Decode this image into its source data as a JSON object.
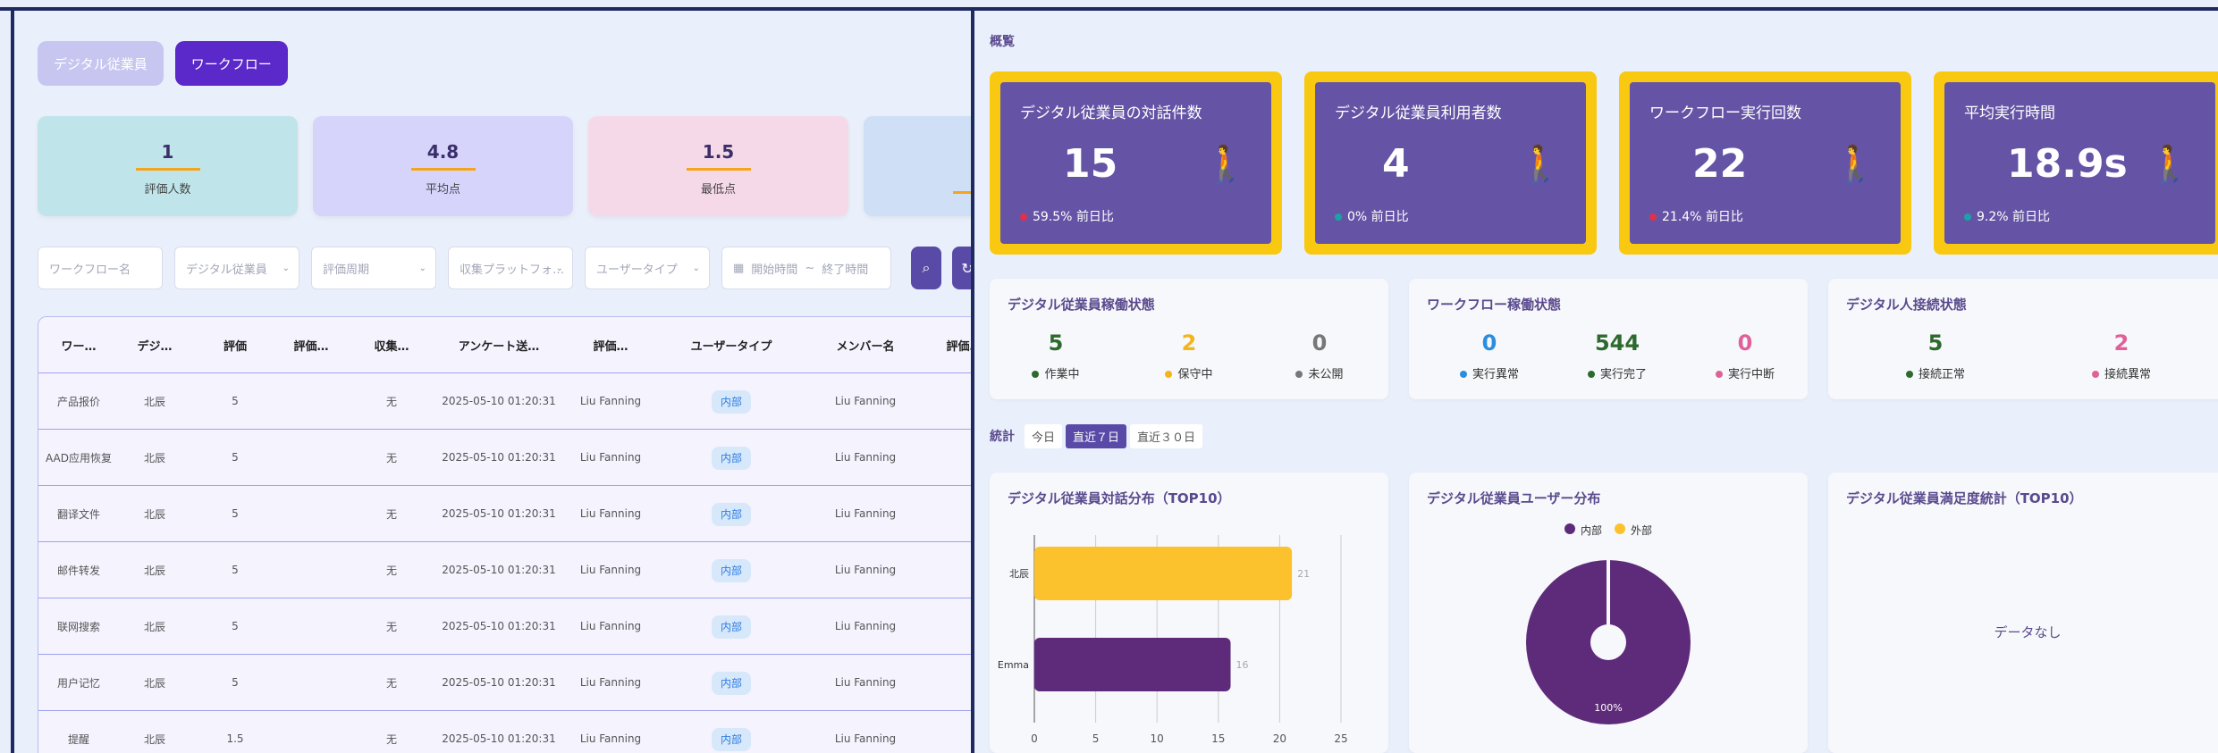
{
  "tabs": {
    "digital": "デジタル従業員",
    "workflow": "ワークフロー"
  },
  "stats": [
    {
      "value": "1",
      "label": "評価人数",
      "bg": "#bfe5ea"
    },
    {
      "value": "4.8",
      "label": "平均点",
      "bg": "#d6d4fb"
    },
    {
      "value": "1.5",
      "label": "最低点",
      "bg": "#f6d9e8"
    }
  ],
  "filters": {
    "workflow_name": "ワークフロー名",
    "digital_employee": "デジタル従業員",
    "eval_period": "評価周期",
    "platform": "収集プラットフォ…",
    "user_type": "ユーザータイプ",
    "start_time": "開始時間",
    "date_sep": "~",
    "end_time": "終了時間"
  },
  "table": {
    "headers": [
      "ワー…",
      "デジ…",
      "評価",
      "評価…",
      "収集…",
      "アンケート送…",
      "評価…",
      "ユーザータイプ",
      "メンバー名",
      "評価…"
    ],
    "rows": [
      [
        "产品报价",
        "北辰",
        "5",
        "",
        "无",
        "2025-05-10 01:20:31",
        "Liu Fanning",
        "内部",
        "Liu Fanning"
      ],
      [
        "AAD应用恢复",
        "北辰",
        "5",
        "",
        "无",
        "2025-05-10 01:20:31",
        "Liu Fanning",
        "内部",
        "Liu Fanning"
      ],
      [
        "翻译文件",
        "北辰",
        "5",
        "",
        "无",
        "2025-05-10 01:20:31",
        "Liu Fanning",
        "内部",
        "Liu Fanning"
      ],
      [
        "邮件转发",
        "北辰",
        "5",
        "",
        "无",
        "2025-05-10 01:20:31",
        "Liu Fanning",
        "内部",
        "Liu Fanning"
      ],
      [
        "联网搜索",
        "北辰",
        "5",
        "",
        "无",
        "2025-05-10 01:20:31",
        "Liu Fanning",
        "内部",
        "Liu Fanning"
      ],
      [
        "用户记忆",
        "北辰",
        "5",
        "",
        "无",
        "2025-05-10 01:20:31",
        "Liu Fanning",
        "内部",
        "Liu Fanning"
      ],
      [
        "提醒",
        "北辰",
        "1.5",
        "",
        "无",
        "2025-05-10 01:20:31",
        "Liu Fanning",
        "内部",
        "Liu Fanning"
      ]
    ]
  },
  "overview": {
    "title": "概覧"
  },
  "kpis": [
    {
      "title": "デジタル従業員の対話件数",
      "value": "15",
      "change": "59.5%",
      "suffix": "前日比",
      "dot": "#e0304a"
    },
    {
      "title": "デジタル従業員利用者数",
      "value": "4",
      "change": "0%",
      "suffix": "前日比",
      "dot": "#1aa3a3"
    },
    {
      "title": "ワークフロー実行回数",
      "value": "22",
      "change": "21.4%",
      "suffix": "前日比",
      "dot": "#e0304a"
    },
    {
      "title": "平均実行時間",
      "value": "18.9s",
      "change": "9.2%",
      "suffix": "前日比",
      "dot": "#1aa3a3"
    }
  ],
  "status": {
    "employee": {
      "title": "デジタル従業員稼働状態",
      "items": [
        {
          "v": "5",
          "l": "作業中",
          "c": "#2d6a2d"
        },
        {
          "v": "2",
          "l": "保守中",
          "c": "#f2b51e"
        },
        {
          "v": "0",
          "l": "未公開",
          "c": "#777"
        }
      ]
    },
    "workflow": {
      "title": "ワークフロー稼働状態",
      "items": [
        {
          "v": "0",
          "l": "実行異常",
          "c": "#2a8ee0"
        },
        {
          "v": "544",
          "l": "実行完了",
          "c": "#2d6a2d"
        },
        {
          "v": "0",
          "l": "実行中断",
          "c": "#e0609a"
        }
      ]
    },
    "human": {
      "title": "デジタル人接続状態",
      "items": [
        {
          "v": "5",
          "l": "接続正常",
          "c": "#2d6a2d"
        },
        {
          "v": "2",
          "l": "接続異常",
          "c": "#e0609a"
        }
      ]
    }
  },
  "stats_section": {
    "title": "統計",
    "today": "今日",
    "last7": "直近７日",
    "last30": "直近３０日"
  },
  "charts": {
    "dialog_title": "デジタル従業員対話分布（TOP10）",
    "user_title": "デジタル従業員ユーザー分布",
    "satisfaction_title": "デジタル従業員満足度統計（TOP10）",
    "no_data": "データなし",
    "pie_label": "100%",
    "legend": [
      "内部",
      "外部"
    ]
  },
  "chart_data": [
    {
      "type": "bar",
      "orientation": "horizontal",
      "categories": [
        "北辰",
        "Emma"
      ],
      "values": [
        21,
        16
      ],
      "xlim": [
        0,
        25
      ],
      "xticks": [
        0,
        5,
        10,
        15,
        20,
        25
      ],
      "colors": [
        "#fcc22e",
        "#5e2b7a"
      ],
      "title": "デジタル従業員対話分布（TOP10）"
    },
    {
      "type": "pie",
      "labels": [
        "内部",
        "外部"
      ],
      "values": [
        100,
        0
      ],
      "colors": [
        "#5e2b7a",
        "#fcc22e"
      ],
      "title": "デジタル従業員ユーザー分布"
    }
  ]
}
